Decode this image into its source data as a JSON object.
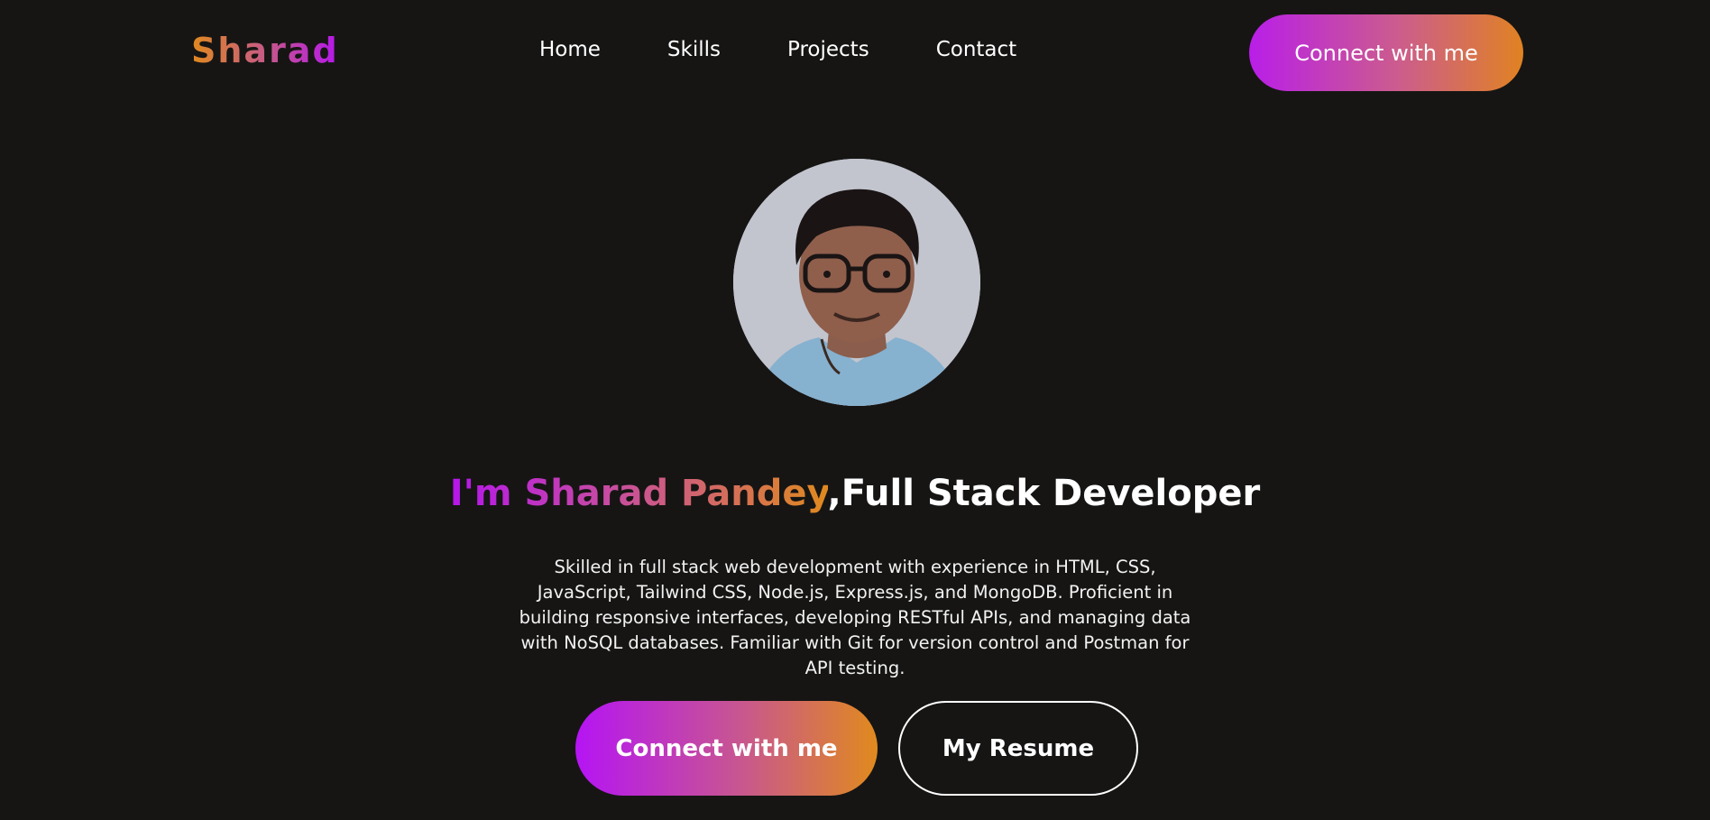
{
  "nav": {
    "logo": "Sharad",
    "links": [
      "Home",
      "Skills",
      "Projects",
      "Contact"
    ],
    "cta_label": "Connect with me"
  },
  "hero": {
    "avatar_alt": "profile-photo",
    "headline_highlight": "I'm Sharad Pandey",
    "headline_comma": ",",
    "headline_rest": "Full Stack Developer",
    "bio": "Skilled in full stack web development with experience in HTML, CSS, JavaScript, Tailwind CSS, Node.js, Express.js, and MongoDB. Proficient in building responsive interfaces, developing RESTful APIs, and managing data with NoSQL databases. Familiar with Git for version control and Postman for API testing.",
    "primary_button": "Connect with me",
    "secondary_button": "My Resume"
  },
  "colors": {
    "background": "#161514",
    "gradient_purple": "#b516ec",
    "gradient_pink": "#c8578f",
    "gradient_orange": "#e08a1e",
    "text": "#ffffff"
  }
}
